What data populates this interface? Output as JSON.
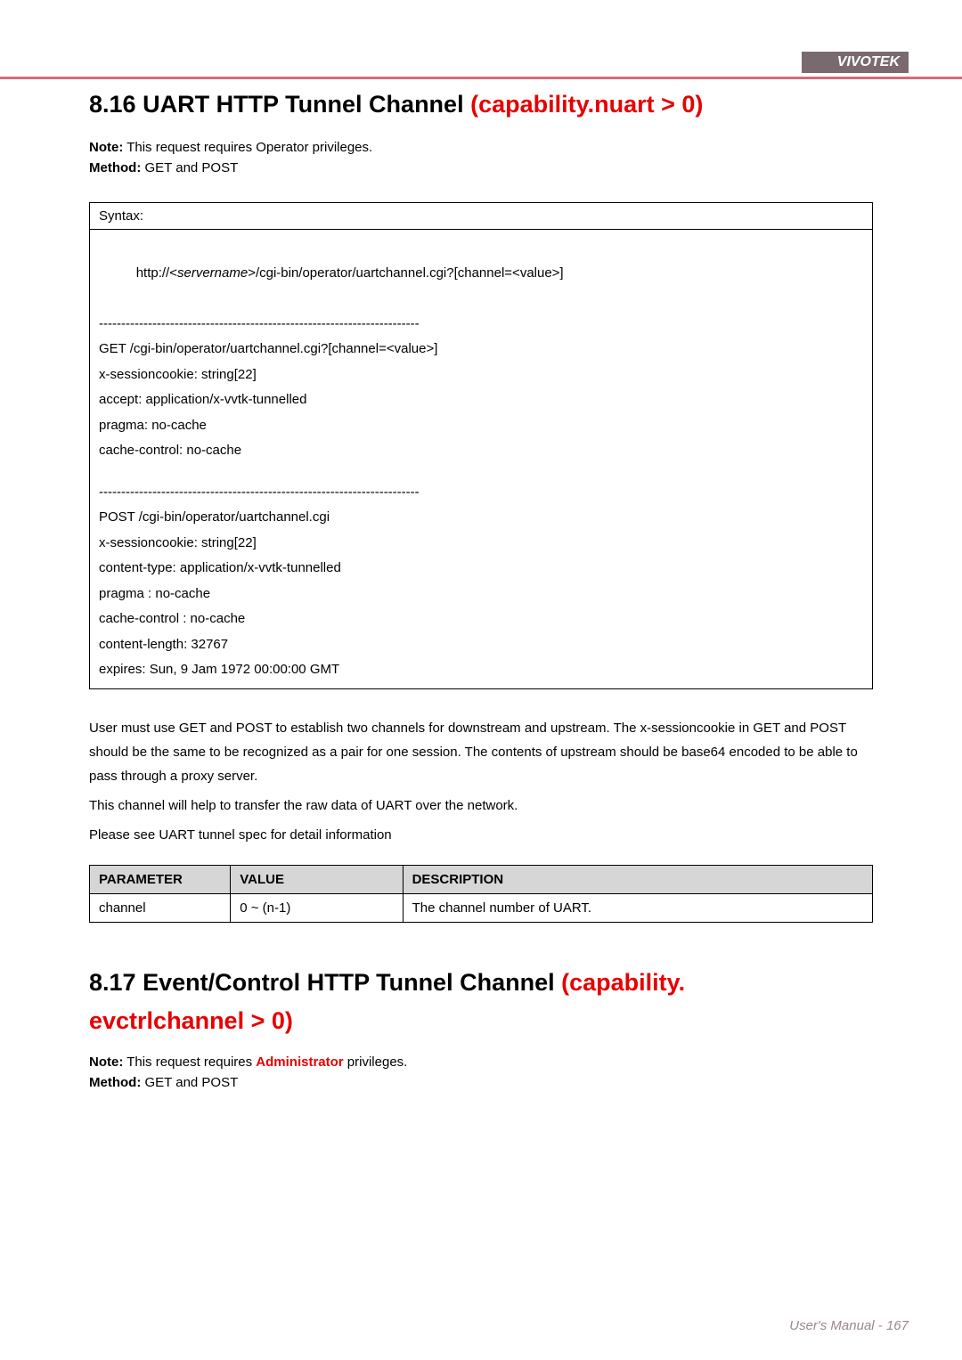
{
  "brand": "VIVOTEK",
  "section1": {
    "number": "8.16",
    "title_black": "UART HTTP Tunnel Channel ",
    "title_red": "(capability.nuart > 0)",
    "note_label": "Note:",
    "note_text": " This request requires Operator privileges.",
    "method_label": "Method:",
    "method_text": " GET and POST",
    "syntax_header": "Syntax:",
    "syntax_line1_a": "http://<",
    "syntax_line1_b": "servername",
    "syntax_line1_c": ">/cgi-bin/operator/uartchannel.cgi?[channel=<value>]",
    "block1": [
      "------------------------------------------------------------------------",
      "GET /cgi-bin/operator/uartchannel.cgi?[channel=<value>]",
      "x-sessioncookie: string[22]",
      "accept: application/x-vvtk-tunnelled",
      "pragma: no-cache",
      "cache-control: no-cache"
    ],
    "block2": [
      "------------------------------------------------------------------------",
      "POST /cgi-bin/operator/uartchannel.cgi",
      "x-sessioncookie: string[22]",
      "content-type: application/x-vvtk-tunnelled",
      "pragma : no-cache",
      "cache-control : no-cache",
      "content-length: 32767",
      "expires: Sun, 9 Jam 1972 00:00:00 GMT"
    ],
    "desc1": "User must use GET and POST to establish two channels for downstream and upstream. The x-sessioncookie in GET and POST should be the same to be recognized as a pair for one session. The contents of upstream should be base64 encoded to be able to pass through a proxy server.",
    "desc2": "This channel will help to transfer the raw data of UART over the network.",
    "desc3": "Please see UART tunnel spec for detail information",
    "param_headers": [
      "PARAMETER",
      "VALUE",
      "DESCRIPTION"
    ],
    "param_row": [
      "channel",
      "0 ~ (n-1)",
      "The channel number of UART."
    ]
  },
  "section2": {
    "number": "8.17",
    "title_black": "Event/Control HTTP Tunnel Channel ",
    "title_red": "(capability.",
    "subcap": "evctrlchannel > 0)",
    "note_label": "Note:",
    "note_text_a": " This request requires Administrator privileges.",
    "method_label": "Method:",
    "method_text": " GET and POST"
  },
  "footer": "User's Manual - 167"
}
